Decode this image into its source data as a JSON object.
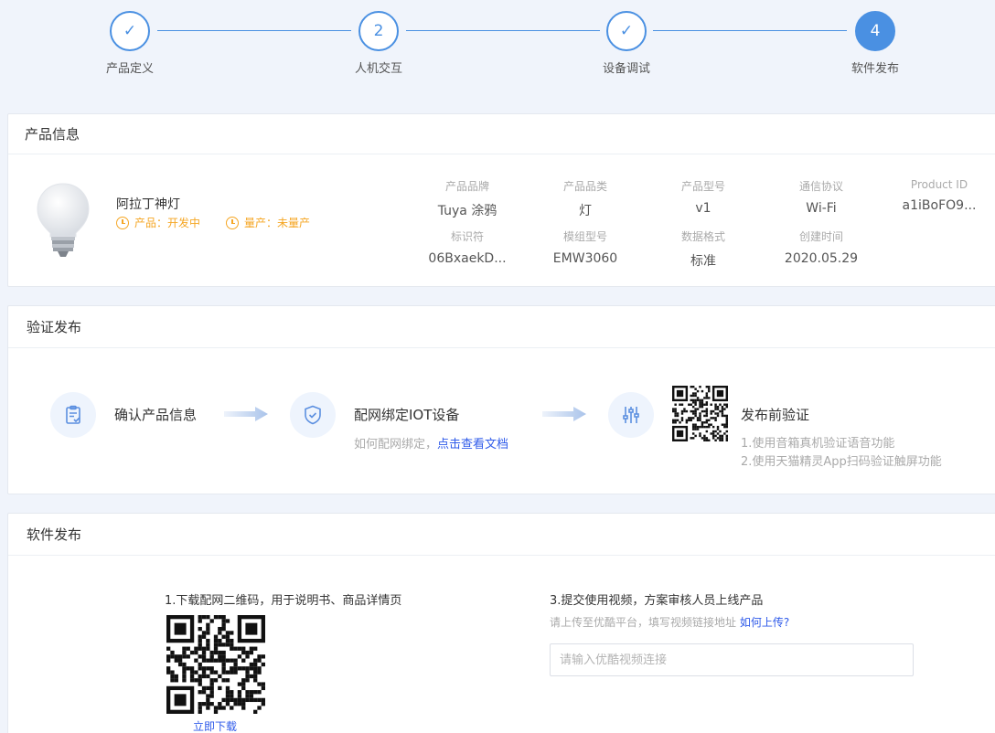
{
  "steps": [
    {
      "label": "产品定义",
      "state": "done",
      "marker": "✓"
    },
    {
      "label": "人机交互",
      "state": "current",
      "marker": "2"
    },
    {
      "label": "设备调试",
      "state": "done",
      "marker": "✓"
    },
    {
      "label": "软件发布",
      "state": "active",
      "marker": "4"
    }
  ],
  "product_info": {
    "title": "产品信息",
    "name": "阿拉丁神灯",
    "status_product": "产品：开发中",
    "status_mass": "量产：未量产",
    "fields": [
      {
        "key": "产品品牌",
        "value": "Tuya 涂鸦"
      },
      {
        "key": "产品品类",
        "value": "灯"
      },
      {
        "key": "产品型号",
        "value": "v1"
      },
      {
        "key": "通信协议",
        "value": "Wi-Fi"
      },
      {
        "key": "Product ID",
        "value": "a1iBoFO9..."
      },
      {
        "key": "标识符",
        "value": "06BxaekD..."
      },
      {
        "key": "模组型号",
        "value": "EMW3060"
      },
      {
        "key": "数据格式",
        "value": "标准"
      },
      {
        "key": "创建时间",
        "value": "2020.05.29"
      }
    ]
  },
  "verify": {
    "title": "验证发布",
    "step1": {
      "title": "确认产品信息",
      "icon": "clipboard-check-icon"
    },
    "step2": {
      "title": "配网绑定IOT设备",
      "hint": "如何配网绑定，",
      "link": "点击查看文档",
      "icon": "shield-check-icon"
    },
    "step3": {
      "title": "发布前验证",
      "line1": "1.使用音箱真机验证语音功能",
      "line2": "2.使用天猫精灵App扫码验证触屏功能",
      "icon": "sliders-icon"
    }
  },
  "release": {
    "title": "软件发布",
    "step1_text": "1.下载配网二维码，用于说明书、商品详情页",
    "download_label": "立即下载",
    "step3_text": "3.提交使用视频，方案审核人员上线产品",
    "step3_hint": "请上传至优酷平台，填写视频链接地址",
    "step3_link": "如何上传?",
    "video_input": {
      "value": "",
      "placeholder": "请输入优酷视频连接"
    }
  },
  "colors": {
    "accent": "#4a90e2",
    "warning": "#f5a623",
    "link": "#2f5bea"
  }
}
